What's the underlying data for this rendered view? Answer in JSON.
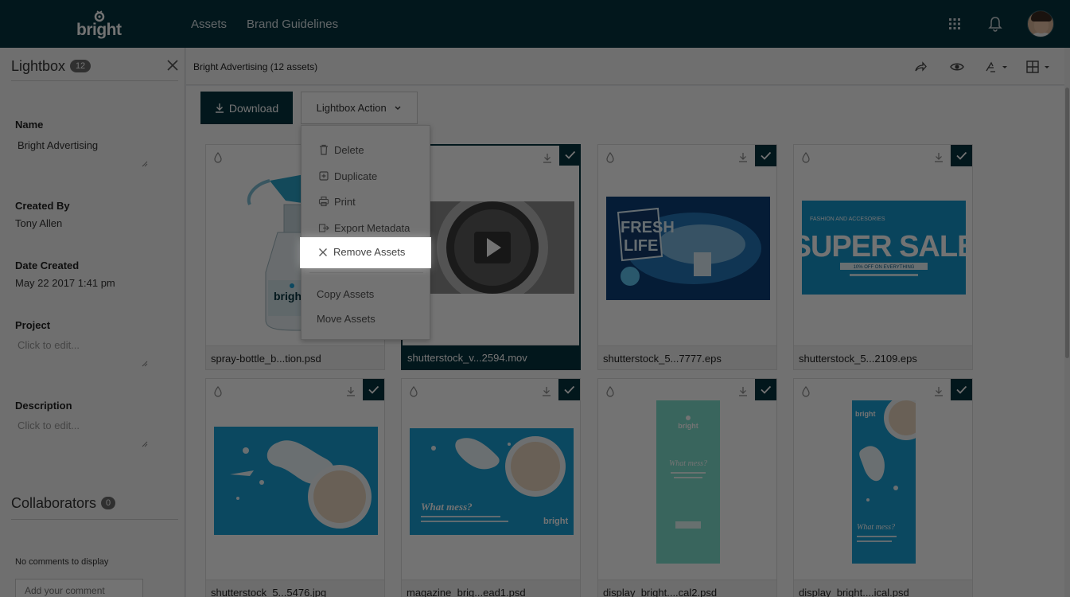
{
  "brand": {
    "name": "bright"
  },
  "nav": {
    "items": [
      "Assets",
      "Brand Guidelines"
    ]
  },
  "lightbox": {
    "title": "Lightbox",
    "count": "12",
    "name_label": "Name",
    "name_value": "Bright Advertising",
    "created_by_label": "Created By",
    "created_by_value": "Tony Allen",
    "date_label": "Date Created",
    "date_value": "May 22 2017 1:41 pm",
    "project_label": "Project",
    "project_placeholder": "Click to edit...",
    "description_label": "Description",
    "description_placeholder": "Click to edit...",
    "collaborators_label": "Collaborators",
    "collaborators_count": "0",
    "no_comments": "No comments to display",
    "comment_placeholder": "Add your comment"
  },
  "main": {
    "breadcrumb": "Bright Advertising (12 assets)",
    "download_label": "Download",
    "lightbox_action_label": "Lightbox Action"
  },
  "dropdown": {
    "items": [
      "Delete",
      "Duplicate",
      "Print",
      "Export Metadata",
      "Remove Assets"
    ],
    "highlighted": "Remove Assets",
    "extra_items": [
      "Copy Assets",
      "Move Assets"
    ]
  },
  "thumb_text": {
    "fresh": "FRESH",
    "life": "LIFE",
    "super_sale_top": "FASHION AND ACCESORIES",
    "super_sale": "SUPER SALE",
    "super_sale_sub": "10% OFF ON EVERYTHING",
    "what_mess": "What mess?",
    "bright_mini": "bright"
  },
  "assets": [
    {
      "name": "spray-bottle_b...tion.psd",
      "checked": false
    },
    {
      "name": "shutterstock_v...2594.mov",
      "checked": true
    },
    {
      "name": "shutterstock_5...7777.eps",
      "checked": true
    },
    {
      "name": "shutterstock_5...2109.eps",
      "checked": true
    },
    {
      "name": "shutterstock_5...5476.jpg",
      "checked": true
    },
    {
      "name": "magazine_brig...ead1.psd",
      "checked": true
    },
    {
      "name": "display_bright....cal2.psd",
      "checked": true
    },
    {
      "name": "display_bright....ical.psd",
      "checked": true
    }
  ],
  "colors": {
    "brand_dark": "#06333f",
    "accent_blue": "#1aa0d4"
  },
  "icons": [
    "grid-icon",
    "bell-icon",
    "share-icon",
    "eye-icon",
    "sort-icon",
    "layout-icon",
    "download-icon",
    "check-icon",
    "drop-icon",
    "trash-icon",
    "duplicate-icon",
    "print-icon",
    "export-icon",
    "close-icon"
  ]
}
